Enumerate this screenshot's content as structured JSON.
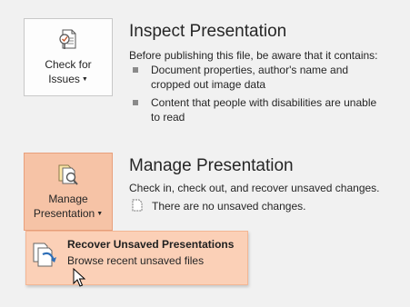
{
  "inspect": {
    "button_line1": "Check for",
    "button_line2": "Issues",
    "heading": "Inspect Presentation",
    "description": "Before publishing this file, be aware that it contains:",
    "bullets": [
      {
        "line1": "Document properties, author's name and",
        "line2": "cropped out image data"
      },
      {
        "line1": "Content that people with disabilities are unable",
        "line2": "to read"
      }
    ]
  },
  "manage": {
    "button_line1": "Manage",
    "button_line2": "Presentation",
    "heading": "Manage Presentation",
    "description": "Check in, check out, and recover unsaved changes.",
    "status": "There are no unsaved changes."
  },
  "dropdown": {
    "title": "Recover Unsaved Presentations",
    "subtitle": "Browse recent unsaved files"
  },
  "colors": {
    "active_button_bg": "#f6c3a6",
    "menu_item_bg": "#fbd0b7",
    "background": "#f1f1f1"
  }
}
